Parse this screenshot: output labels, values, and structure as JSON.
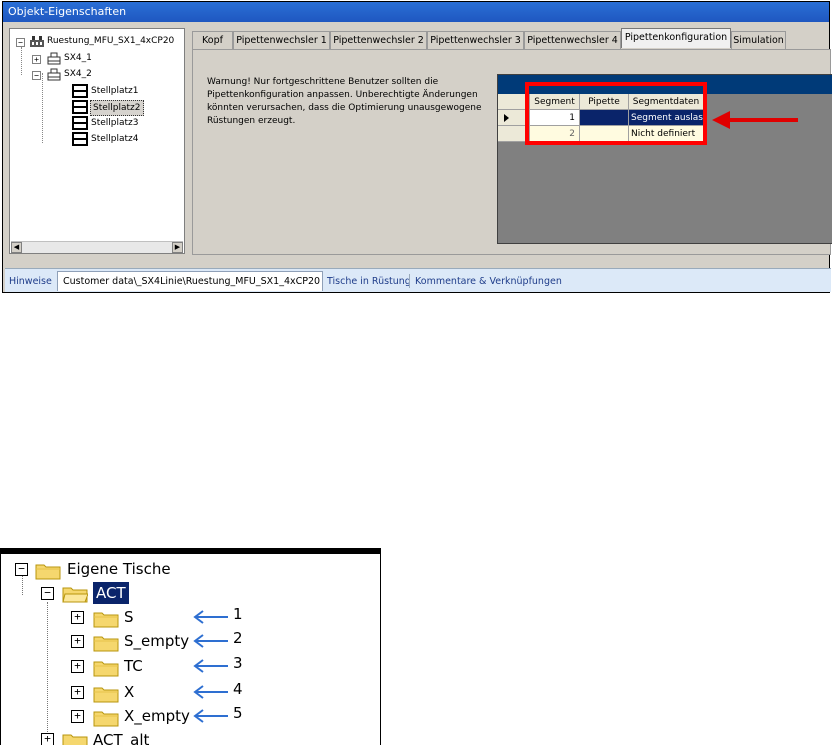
{
  "window1": {
    "title": "Objekt-Eigenschaften",
    "tree": {
      "root": "Ruestung_MFU_SX1_4xCP20",
      "children": [
        "SX4_1",
        "SX4_2"
      ],
      "slots": [
        "Stellplatz1",
        "Stellplatz2",
        "Stellplatz3",
        "Stellplatz4"
      ],
      "selected": "Stellplatz2"
    },
    "tabs": [
      "Kopf",
      "Pipettenwechsler 1",
      "Pipettenwechsler 2",
      "Pipettenwechsler 3",
      "Pipettenwechsler 4",
      "Pipettenkonfiguration",
      "Simulation"
    ],
    "active_tab": "Pipettenkonfiguration",
    "warning": "Warnung! Nur fortgeschrittene Benutzer sollten die Pipettenkonfiguration anpassen. Unberechtigte Änderungen könnten verursachen, dass die Optimierung unausgewogene Rüstungen erzeugt.",
    "grid": {
      "columns": [
        "Segment",
        "Pipette",
        "Segmentdaten"
      ],
      "rows": [
        {
          "segment": "1",
          "pipette": "",
          "data": "Segment auslass"
        },
        {
          "segment": "2",
          "pipette": "",
          "data": "Nicht definiert"
        }
      ]
    },
    "bottom_tabs": [
      "Hinweise",
      "Customer data\\_SX4Linie\\Ruestung_MFU_SX1_4xCP20",
      "Tische in Rüstung",
      "Kommentare & Verknüpfungen"
    ],
    "colors": {
      "title": "#1f57c0",
      "grid_header": "#003a78",
      "highlight": "#ff0000"
    }
  },
  "window2": {
    "root": "Eigene Tische",
    "group": "ACT",
    "folders": [
      "S",
      "S_empty",
      "TC",
      "X",
      "X_empty"
    ],
    "numbers": [
      "1",
      "2",
      "3",
      "4",
      "5"
    ],
    "next": "ACT_alt"
  }
}
